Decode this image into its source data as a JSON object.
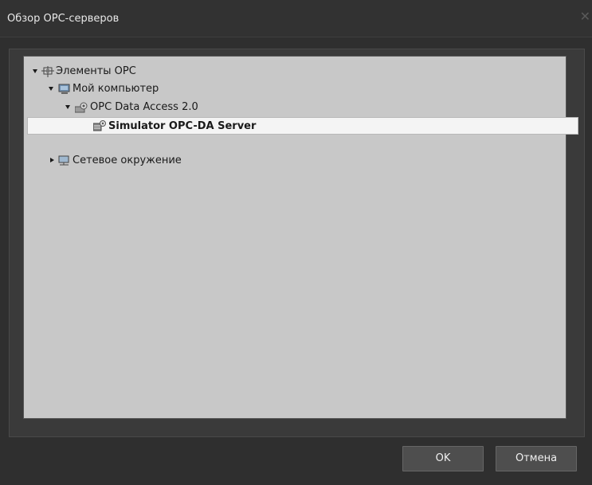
{
  "window": {
    "title": "Обзор OPC-серверов"
  },
  "tree": {
    "items": [
      {
        "label": "Элементы OPC",
        "icon": "network-nodes-icon",
        "expanded": true
      },
      {
        "label": "Мой компьютер",
        "icon": "computer-icon",
        "expanded": true
      },
      {
        "label": "OPC Data Access 2.0",
        "icon": "folder-gear-icon",
        "expanded": true
      },
      {
        "label": "Simulator OPC-DA Server",
        "icon": "server-gear-icon",
        "selected": true
      },
      {
        "label": "Сетевое окружение",
        "icon": "network-computer-icon",
        "expanded": false
      }
    ]
  },
  "buttons": {
    "ok": "OK",
    "cancel": "Отмена"
  }
}
